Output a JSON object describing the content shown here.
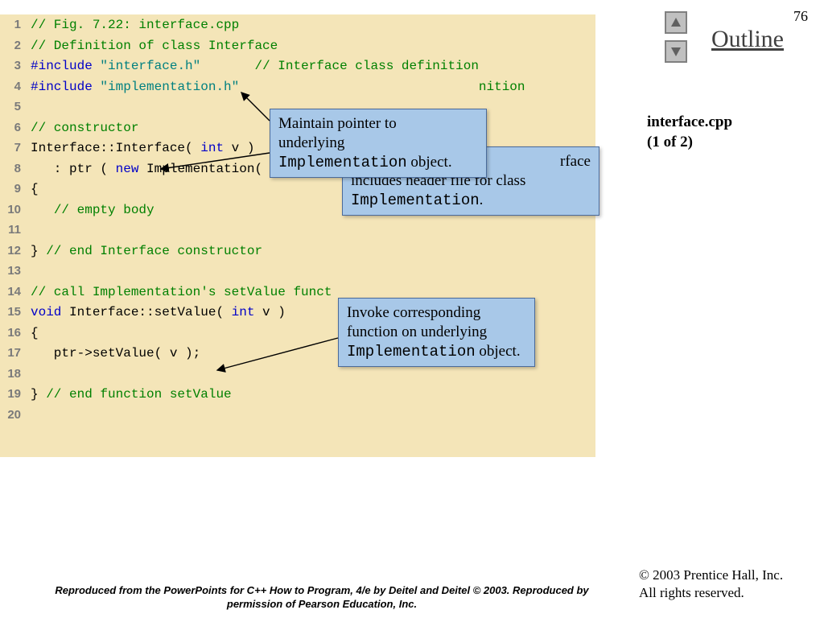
{
  "page_number": "76",
  "outline_label": "Outline",
  "side": {
    "filename": "interface.cpp",
    "part": "(1 of 2)"
  },
  "nav": {
    "up": "▲",
    "down": "▼"
  },
  "code": [
    {
      "n": "1",
      "segs": [
        {
          "cls": "c-comment",
          "t": "// Fig. 7.22: interface.cpp"
        }
      ]
    },
    {
      "n": "2",
      "segs": [
        {
          "cls": "c-comment",
          "t": "// Definition of class Interface"
        }
      ]
    },
    {
      "n": "3",
      "segs": [
        {
          "cls": "c-keyword",
          "t": "#include"
        },
        {
          "cls": "c-plain",
          "t": " "
        },
        {
          "cls": "c-string",
          "t": "\"interface.h\""
        },
        {
          "cls": "c-plain",
          "t": "       "
        },
        {
          "cls": "c-comment",
          "t": "// Interface class definition"
        }
      ]
    },
    {
      "n": "4",
      "segs": [
        {
          "cls": "c-keyword",
          "t": "#include"
        },
        {
          "cls": "c-plain",
          "t": " "
        },
        {
          "cls": "c-string",
          "t": "\"implementation.h\""
        },
        {
          "cls": "c-plain",
          "t": "  "
        },
        {
          "cls": "c-comment",
          "t": "                             nition"
        }
      ]
    },
    {
      "n": "5",
      "segs": [
        {
          "cls": "c-plain",
          "t": ""
        }
      ]
    },
    {
      "n": "6",
      "segs": [
        {
          "cls": "c-comment",
          "t": "// constructor"
        }
      ]
    },
    {
      "n": "7",
      "segs": [
        {
          "cls": "c-plain",
          "t": "Interface::Interface( "
        },
        {
          "cls": "c-keyword",
          "t": "int"
        },
        {
          "cls": "c-plain",
          "t": " v )               rface"
        }
      ]
    },
    {
      "n": "8",
      "segs": [
        {
          "cls": "c-plain",
          "t": "   : ptr ( "
        },
        {
          "cls": "c-keyword",
          "t": "new"
        },
        {
          "cls": "c-plain",
          "t": " Implementation( v ) )  //"
        }
      ]
    },
    {
      "n": "9",
      "segs": [
        {
          "cls": "c-plain",
          "t": "{ "
        }
      ]
    },
    {
      "n": "10",
      "segs": [
        {
          "cls": "c-plain",
          "t": "   "
        },
        {
          "cls": "c-comment",
          "t": "// empty body"
        }
      ]
    },
    {
      "n": "11",
      "segs": [
        {
          "cls": "c-plain",
          "t": ""
        }
      ]
    },
    {
      "n": "12",
      "segs": [
        {
          "cls": "c-plain",
          "t": "} "
        },
        {
          "cls": "c-comment",
          "t": "// end Interface constructor"
        }
      ]
    },
    {
      "n": "13",
      "segs": [
        {
          "cls": "c-plain",
          "t": ""
        }
      ]
    },
    {
      "n": "14",
      "segs": [
        {
          "cls": "c-comment",
          "t": "// call Implementation's setValue funct"
        }
      ]
    },
    {
      "n": "15",
      "segs": [
        {
          "cls": "c-keyword",
          "t": "void"
        },
        {
          "cls": "c-plain",
          "t": " Interface::setValue( "
        },
        {
          "cls": "c-keyword",
          "t": "int"
        },
        {
          "cls": "c-plain",
          "t": " v )"
        }
      ]
    },
    {
      "n": "16",
      "segs": [
        {
          "cls": "c-plain",
          "t": "{ "
        }
      ]
    },
    {
      "n": "17",
      "segs": [
        {
          "cls": "c-plain",
          "t": "   ptr->setValue( v );"
        }
      ]
    },
    {
      "n": "18",
      "segs": [
        {
          "cls": "c-plain",
          "t": ""
        }
      ]
    },
    {
      "n": "19",
      "segs": [
        {
          "cls": "c-plain",
          "t": "} "
        },
        {
          "cls": "c-comment",
          "t": "// end function setValue"
        }
      ]
    },
    {
      "n": "20",
      "segs": [
        {
          "cls": "c-plain",
          "t": ""
        }
      ]
    }
  ],
  "callouts": {
    "c1": {
      "l1": "Maintain pointer to",
      "l2": "underlying",
      "l3a": "Implementation",
      "l3b": " object."
    },
    "c2": {
      "l1": "includes header file for class",
      "l2": "Implementation",
      "l2b": "."
    },
    "c3": {
      "l1": "Invoke corresponding",
      "l2": "function on underlying",
      "l3a": "Implementation",
      "l3b": " object."
    }
  },
  "footer": {
    "repro": "Reproduced from the PowerPoints for C++ How to Program, 4/e by Deitel and Deitel © 2003. Reproduced by permission of Pearson Education, Inc.",
    "copy1": "© 2003 Prentice Hall, Inc.",
    "copy2": "All rights reserved."
  }
}
